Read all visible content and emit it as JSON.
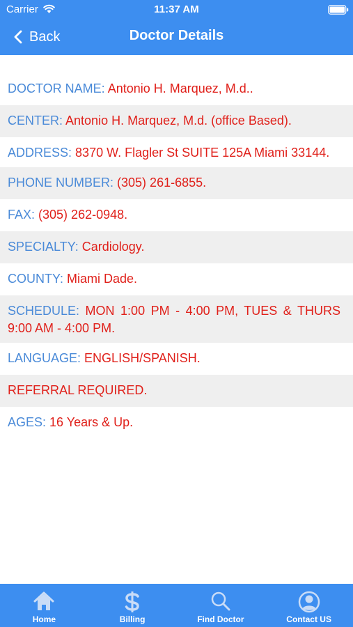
{
  "status_bar": {
    "carrier": "Carrier",
    "time": "11:37 AM"
  },
  "nav": {
    "back_label": "Back",
    "title": "Doctor Details"
  },
  "details": [
    {
      "label": "DOCTOR NAME:",
      "value": "Antonio H. Marquez, M.d.."
    },
    {
      "label": "CENTER:",
      "value": "Antonio H. Marquez, M.d. (office Based)."
    },
    {
      "label": "ADDRESS:",
      "value": "8370 W. Flagler St SUITE 125A Miami 33144."
    },
    {
      "label": "PHONE NUMBER:",
      "value": "(305) 261-6855."
    },
    {
      "label": "FAX:",
      "value": "(305) 262-0948."
    },
    {
      "label": "SPECIALTY:",
      "value": "Cardiology."
    },
    {
      "label": "COUNTY:",
      "value": "Miami Dade."
    },
    {
      "label": "SCHEDULE:",
      "value": "MON 1:00 PM - 4:00 PM, TUES & THURS 9:00 AM - 4:00 PM."
    },
    {
      "label": "LANGUAGE:",
      "value": "ENGLISH/SPANISH."
    },
    {
      "label": "",
      "value": "REFERRAL REQUIRED."
    },
    {
      "label": "AGES:",
      "value": "16 Years & Up."
    }
  ],
  "tabbar": {
    "items": [
      {
        "label": "Home",
        "icon": "home-icon"
      },
      {
        "label": "Billing",
        "icon": "dollar-icon"
      },
      {
        "label": "Find Doctor",
        "icon": "search-icon"
      },
      {
        "label": "Contact US",
        "icon": "user-icon"
      }
    ]
  },
  "colors": {
    "header": "#3d8ef0",
    "label": "#4a8ad8",
    "value": "#e0201a",
    "alt_row": "#efefef"
  }
}
